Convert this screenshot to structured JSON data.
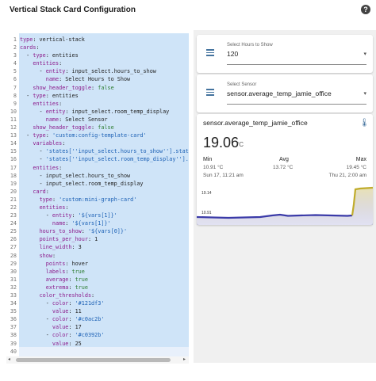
{
  "header": {
    "title": "Vertical Stack Card Configuration",
    "help_icon": "help-circle-icon",
    "help_glyph": "?"
  },
  "editor": {
    "lines": [
      [
        {
          "t": "type",
          "c": "k"
        },
        {
          "t": ": vertical-stack",
          "c": ""
        }
      ],
      [
        {
          "t": "cards",
          "c": "k"
        },
        {
          "t": ":",
          "c": ""
        }
      ],
      [
        {
          "t": "  - ",
          "c": ""
        },
        {
          "t": "type",
          "c": "k"
        },
        {
          "t": ": entities",
          "c": ""
        }
      ],
      [
        {
          "t": "    ",
          "c": ""
        },
        {
          "t": "entities",
          "c": "k"
        },
        {
          "t": ":",
          "c": ""
        }
      ],
      [
        {
          "t": "      - ",
          "c": ""
        },
        {
          "t": "entity",
          "c": "k"
        },
        {
          "t": ": input_select.hours_to_show",
          "c": ""
        }
      ],
      [
        {
          "t": "        ",
          "c": ""
        },
        {
          "t": "name",
          "c": "k"
        },
        {
          "t": ": Select Hours to Show",
          "c": ""
        }
      ],
      [
        {
          "t": "    ",
          "c": ""
        },
        {
          "t": "show_header_toggle",
          "c": "k"
        },
        {
          "t": ": ",
          "c": ""
        },
        {
          "t": "false",
          "c": "b"
        }
      ],
      [
        {
          "t": "  - ",
          "c": ""
        },
        {
          "t": "type",
          "c": "k"
        },
        {
          "t": ": entities",
          "c": ""
        }
      ],
      [
        {
          "t": "    ",
          "c": ""
        },
        {
          "t": "entities",
          "c": "k"
        },
        {
          "t": ":",
          "c": ""
        }
      ],
      [
        {
          "t": "      - ",
          "c": ""
        },
        {
          "t": "entity",
          "c": "k"
        },
        {
          "t": ": input_select.room_temp_display",
          "c": ""
        }
      ],
      [
        {
          "t": "        ",
          "c": ""
        },
        {
          "t": "name",
          "c": "k"
        },
        {
          "t": ": Select Sensor",
          "c": ""
        }
      ],
      [
        {
          "t": "    ",
          "c": ""
        },
        {
          "t": "show_header_toggle",
          "c": "k"
        },
        {
          "t": ": ",
          "c": ""
        },
        {
          "t": "false",
          "c": "b"
        }
      ],
      [
        {
          "t": "  - ",
          "c": ""
        },
        {
          "t": "type",
          "c": "k"
        },
        {
          "t": ": ",
          "c": ""
        },
        {
          "t": "'custom:config-template-card'",
          "c": "s"
        }
      ],
      [
        {
          "t": "    ",
          "c": ""
        },
        {
          "t": "variables",
          "c": "k"
        },
        {
          "t": ":",
          "c": ""
        }
      ],
      [
        {
          "t": "      - ",
          "c": ""
        },
        {
          "t": "'states[''input_select.hours_to_show''].stat",
          "c": "s"
        }
      ],
      [
        {
          "t": "      - ",
          "c": ""
        },
        {
          "t": "'states[''input_select.room_temp_display''].",
          "c": "s"
        }
      ],
      [
        {
          "t": "    ",
          "c": ""
        },
        {
          "t": "entities",
          "c": "k"
        },
        {
          "t": ":",
          "c": ""
        }
      ],
      [
        {
          "t": "      - input_select.hours_to_show",
          "c": ""
        }
      ],
      [
        {
          "t": "      - input_select.room_temp_display",
          "c": ""
        }
      ],
      [
        {
          "t": "    ",
          "c": ""
        },
        {
          "t": "card",
          "c": "k"
        },
        {
          "t": ":",
          "c": ""
        }
      ],
      [
        {
          "t": "      ",
          "c": ""
        },
        {
          "t": "type",
          "c": "k"
        },
        {
          "t": ": ",
          "c": ""
        },
        {
          "t": "'custom:mini-graph-card'",
          "c": "s"
        }
      ],
      [
        {
          "t": "      ",
          "c": ""
        },
        {
          "t": "entities",
          "c": "k"
        },
        {
          "t": ":",
          "c": ""
        }
      ],
      [
        {
          "t": "        - ",
          "c": ""
        },
        {
          "t": "entity",
          "c": "k"
        },
        {
          "t": ": ",
          "c": ""
        },
        {
          "t": "'${vars[1]}'",
          "c": "s"
        }
      ],
      [
        {
          "t": "          ",
          "c": ""
        },
        {
          "t": "name",
          "c": "k"
        },
        {
          "t": ": ",
          "c": ""
        },
        {
          "t": "'${vars[1]}'",
          "c": "s"
        }
      ],
      [
        {
          "t": "      ",
          "c": ""
        },
        {
          "t": "hours_to_show",
          "c": "k"
        },
        {
          "t": ": ",
          "c": ""
        },
        {
          "t": "'${vars[0]}'",
          "c": "s"
        }
      ],
      [
        {
          "t": "      ",
          "c": ""
        },
        {
          "t": "points_per_hour",
          "c": "k"
        },
        {
          "t": ": 1",
          "c": ""
        }
      ],
      [
        {
          "t": "      ",
          "c": ""
        },
        {
          "t": "line_width",
          "c": "k"
        },
        {
          "t": ": 3",
          "c": ""
        }
      ],
      [
        {
          "t": "      ",
          "c": ""
        },
        {
          "t": "show",
          "c": "k"
        },
        {
          "t": ":",
          "c": ""
        }
      ],
      [
        {
          "t": "        ",
          "c": ""
        },
        {
          "t": "points",
          "c": "k"
        },
        {
          "t": ": hover",
          "c": ""
        }
      ],
      [
        {
          "t": "        ",
          "c": ""
        },
        {
          "t": "labels",
          "c": "k"
        },
        {
          "t": ": ",
          "c": ""
        },
        {
          "t": "true",
          "c": "b"
        }
      ],
      [
        {
          "t": "        ",
          "c": ""
        },
        {
          "t": "average",
          "c": "k"
        },
        {
          "t": ": ",
          "c": ""
        },
        {
          "t": "true",
          "c": "b"
        }
      ],
      [
        {
          "t": "        ",
          "c": ""
        },
        {
          "t": "extrema",
          "c": "k"
        },
        {
          "t": ": ",
          "c": ""
        },
        {
          "t": "true",
          "c": "b"
        }
      ],
      [
        {
          "t": "      ",
          "c": ""
        },
        {
          "t": "color_thresholds",
          "c": "k"
        },
        {
          "t": ":",
          "c": ""
        }
      ],
      [
        {
          "t": "        - ",
          "c": ""
        },
        {
          "t": "color",
          "c": "k"
        },
        {
          "t": ": ",
          "c": ""
        },
        {
          "t": "'#121df3'",
          "c": "s"
        }
      ],
      [
        {
          "t": "          ",
          "c": ""
        },
        {
          "t": "value",
          "c": "k"
        },
        {
          "t": ": 11",
          "c": ""
        }
      ],
      [
        {
          "t": "        - ",
          "c": ""
        },
        {
          "t": "color",
          "c": "k"
        },
        {
          "t": ": ",
          "c": ""
        },
        {
          "t": "'#c0ac2b'",
          "c": "s"
        }
      ],
      [
        {
          "t": "          ",
          "c": ""
        },
        {
          "t": "value",
          "c": "k"
        },
        {
          "t": ": 17",
          "c": ""
        }
      ],
      [
        {
          "t": "        - ",
          "c": ""
        },
        {
          "t": "color",
          "c": "k"
        },
        {
          "t": ": ",
          "c": ""
        },
        {
          "t": "'#c0392b'",
          "c": "s"
        }
      ],
      [
        {
          "t": "          ",
          "c": ""
        },
        {
          "t": "value",
          "c": "k"
        },
        {
          "t": ": 25",
          "c": ""
        }
      ],
      [
        {
          "t": "",
          "c": ""
        }
      ]
    ],
    "scroll_left_glyph": "◂",
    "scroll_right_glyph": "▸"
  },
  "preview": {
    "hours_select": {
      "icon": "format-list-bulleted-icon",
      "label": "Select Hours to Show",
      "value": "120",
      "caret": "▾"
    },
    "sensor_select": {
      "icon": "format-list-bulleted-icon",
      "label": "Select Sensor",
      "value": "sensor.average_temp_jamie_office",
      "caret": "▾"
    },
    "graph": {
      "name": "sensor.average_temp_jamie_office",
      "icon": "thermometer-icon",
      "icon_glyph": "🌡",
      "state": "19.06",
      "unit": "°C",
      "stats": {
        "min_label": "Min",
        "min_value": "10.91 °C",
        "min_time": "Sun 17, 11:21 am",
        "avg_label": "Avg",
        "avg_value": "13.72 °C",
        "max_label": "Max",
        "max_value": "19.45 °C",
        "max_time": "Thu 21, 2:00 am"
      },
      "axis_top_label": "19.14",
      "axis_bottom_label": "10.91",
      "line_color": "#3a3aa8",
      "line_color_high": "#c0ac2b"
    }
  }
}
